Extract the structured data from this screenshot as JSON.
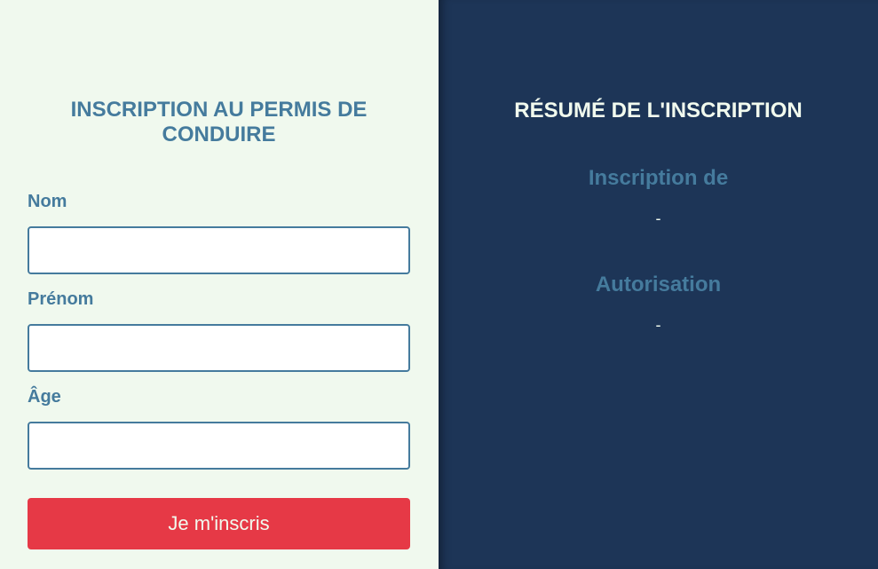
{
  "form": {
    "title": "INSCRIPTION AU PERMIS DE CONDUIRE",
    "fields": [
      {
        "label": "Nom",
        "value": "",
        "placeholder": ""
      },
      {
        "label": "Prénom",
        "value": "",
        "placeholder": ""
      },
      {
        "label": "Âge",
        "value": "",
        "placeholder": ""
      }
    ],
    "submit_label": "Je m'inscris"
  },
  "summary": {
    "title": "RÉSUMÉ DE L'INSCRIPTION",
    "sections": [
      {
        "heading": "Inscription de",
        "value": "-"
      },
      {
        "heading": "Autorisation",
        "value": "-"
      }
    ]
  },
  "colors": {
    "form_background": "#f0f9ee",
    "summary_background": "#1d3557",
    "accent": "#457b9d",
    "button": "#e63946",
    "light_text": "#f1faee"
  }
}
